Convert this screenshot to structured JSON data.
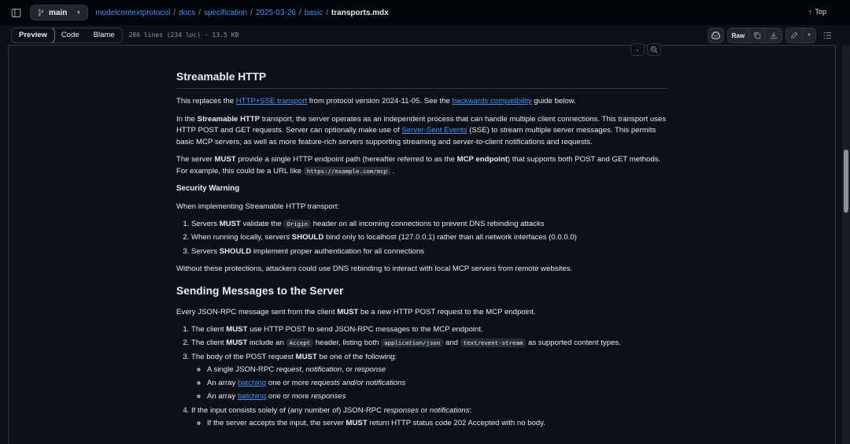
{
  "topbar": {
    "branch": "main",
    "breadcrumb": [
      "modelcontextprotocol",
      "docs",
      "specification",
      "2025-03-26",
      "basic"
    ],
    "current_file": "transports.mdx",
    "top_label": "Top"
  },
  "toolbar": {
    "tabs": [
      "Preview",
      "Code",
      "Blame"
    ],
    "active_tab": "Preview",
    "meta": "286 lines (234 loc) · 13.5 KB",
    "raw_label": "Raw"
  },
  "doc": {
    "h_streamable": "Streamable HTTP",
    "p1": {
      "t1": "This replaces the ",
      "link1": "HTTP+SSE transport",
      "t2": " from protocol version 2024-11-05. See the ",
      "link2": "backwards compatibility",
      "t3": " guide below."
    },
    "p2": {
      "t1": "In the ",
      "b1": "Streamable HTTP",
      "t2": " transport, the server operates as an independent process that can handle multiple client connections. This transport uses HTTP POST and GET requests. Server can optionally make use of ",
      "link": "Server-Sent Events",
      "t3": " (SSE) to stream multiple server messages. This permits basic MCP servers, as well as more feature-rich servers supporting streaming and server-to-client notifications and requests."
    },
    "p3": {
      "t1": "The server ",
      "b1": "MUST",
      "t2": " provide a single HTTP endpoint path (hereafter referred to as the ",
      "b2": "MCP endpoint",
      "t3": ") that supports both POST and GET methods. For example, this could be a URL like ",
      "code": "https://example.com/mcp",
      "t4": " ."
    },
    "h_security": "Security Warning",
    "p4": "When implementing Streamable HTTP transport:",
    "sec_list": [
      {
        "t1": "Servers ",
        "b": "MUST",
        "t2": " validate the ",
        "code": "Origin",
        "t3": " header on all incoming connections to prevent DNS rebinding attacks"
      },
      {
        "t1": "When running locally, servers ",
        "b": "SHOULD",
        "t2": " bind only to localhost (127.0.0.1) rather than all network interfaces (0.0.0.0)"
      },
      {
        "t1": "Servers ",
        "b": "SHOULD",
        "t2": " implement proper authentication for all connections"
      }
    ],
    "p5": "Without these protections, attackers could use DNS rebinding to interact with local MCP servers from remote websites.",
    "h_sending": "Sending Messages to the Server",
    "p6": {
      "t1": "Every JSON-RPC message sent from the client ",
      "b": "MUST",
      "t2": " be a new HTTP POST request to the MCP endpoint."
    },
    "send_list": {
      "i1": {
        "t1": "The client ",
        "b": "MUST",
        "t2": " use HTTP POST to send JSON-RPC messages to the MCP endpoint."
      },
      "i2": {
        "t1": "The client ",
        "b": "MUST",
        "t2": " include an ",
        "c1": "Accept",
        "t3": " header, listing both ",
        "c2": "application/json",
        "t4": " and ",
        "c3": "text/event-stream",
        "t5": " as supported content types."
      },
      "i3": {
        "t1": "The body of the POST request ",
        "b": "MUST",
        "t2": " be one of the following:"
      },
      "i3_sub": {
        "a": {
          "t1": "A single JSON-RPC ",
          "e1": "request",
          "t2": ", ",
          "e2": "notification",
          "t3": ", or ",
          "e3": "response"
        },
        "b": {
          "t1": "An array ",
          "link": "batching",
          "t2": " one or more ",
          "e": "requests and/or notifications"
        },
        "c": {
          "t1": "An array ",
          "link": "batching",
          "t2": " one or more ",
          "e": "responses"
        }
      },
      "i4": {
        "t1": "If the input consists solely of (any number of) JSON-RPC ",
        "e1": "responses",
        "t2": " or ",
        "e2": "notifications",
        "t3": ":"
      },
      "i4_sub": {
        "t1": "If the server accepts the input, the server ",
        "b": "MUST",
        "t2": " return HTTP status code 202 Accepted with no body."
      }
    }
  }
}
